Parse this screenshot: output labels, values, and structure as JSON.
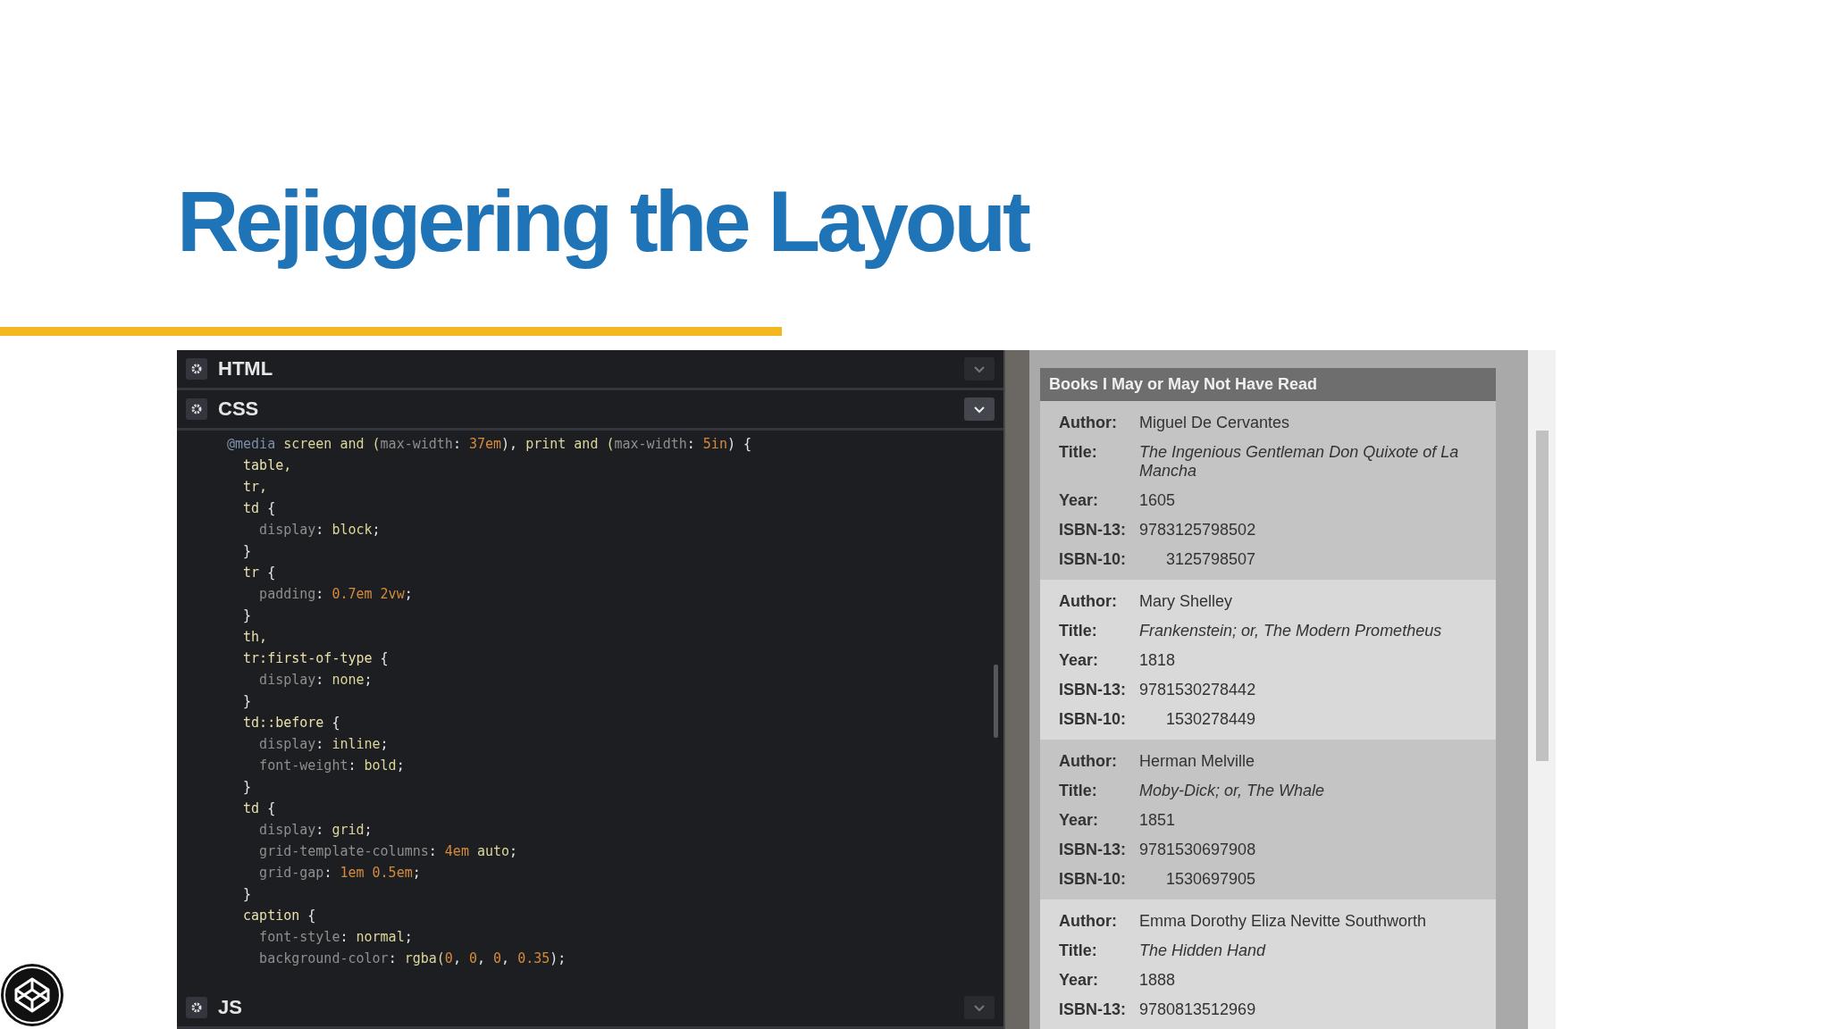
{
  "slide": {
    "title": "Rejiggering the Layout"
  },
  "editor": {
    "panels": [
      {
        "label": "HTML",
        "expanded": false
      },
      {
        "label": "CSS",
        "expanded": true
      },
      {
        "label": "JS",
        "expanded": false
      }
    ],
    "css_lines": [
      [
        {
          "kind": "at",
          "text": "@media"
        },
        {
          "kind": "val",
          "text": " screen and ("
        },
        {
          "kind": "prop",
          "text": "max-width"
        },
        {
          "kind": "punct",
          "text": ": "
        },
        {
          "kind": "num",
          "text": "37em"
        },
        {
          "kind": "punct",
          "text": "), "
        },
        {
          "kind": "val",
          "text": "print and ("
        },
        {
          "kind": "prop",
          "text": "max-width"
        },
        {
          "kind": "punct",
          "text": ": "
        },
        {
          "kind": "num",
          "text": "5in"
        },
        {
          "kind": "punct",
          "text": ") {"
        }
      ],
      [
        {
          "kind": "sel",
          "text": "  table,"
        }
      ],
      [
        {
          "kind": "sel",
          "text": "  tr,"
        }
      ],
      [
        {
          "kind": "sel",
          "text": "  td"
        },
        {
          "kind": "punct",
          "text": " {"
        }
      ],
      [
        {
          "kind": "prop",
          "text": "    display"
        },
        {
          "kind": "punct",
          "text": ": "
        },
        {
          "kind": "val",
          "text": "block"
        },
        {
          "kind": "punct",
          "text": ";"
        }
      ],
      [
        {
          "kind": "punct",
          "text": "  }"
        }
      ],
      [
        {
          "kind": "sel",
          "text": "  tr"
        },
        {
          "kind": "punct",
          "text": " {"
        }
      ],
      [
        {
          "kind": "prop",
          "text": "    padding"
        },
        {
          "kind": "punct",
          "text": ": "
        },
        {
          "kind": "num",
          "text": "0.7em 2vw"
        },
        {
          "kind": "punct",
          "text": ";"
        }
      ],
      [
        {
          "kind": "punct",
          "text": "  }"
        }
      ],
      [
        {
          "kind": "sel",
          "text": "  th,"
        }
      ],
      [
        {
          "kind": "sel",
          "text": "  tr:first-of-type"
        },
        {
          "kind": "punct",
          "text": " {"
        }
      ],
      [
        {
          "kind": "prop",
          "text": "    display"
        },
        {
          "kind": "punct",
          "text": ": "
        },
        {
          "kind": "val",
          "text": "none"
        },
        {
          "kind": "punct",
          "text": ";"
        }
      ],
      [
        {
          "kind": "punct",
          "text": "  }"
        }
      ],
      [
        {
          "kind": "sel",
          "text": "  td::before"
        },
        {
          "kind": "punct",
          "text": " {"
        }
      ],
      [
        {
          "kind": "prop",
          "text": "    display"
        },
        {
          "kind": "punct",
          "text": ": "
        },
        {
          "kind": "val",
          "text": "inline"
        },
        {
          "kind": "punct",
          "text": ";"
        }
      ],
      [
        {
          "kind": "prop",
          "text": "    font-weight"
        },
        {
          "kind": "punct",
          "text": ": "
        },
        {
          "kind": "val",
          "text": "bold"
        },
        {
          "kind": "punct",
          "text": ";"
        }
      ],
      [
        {
          "kind": "punct",
          "text": "  }"
        }
      ],
      [
        {
          "kind": "sel",
          "text": "  td"
        },
        {
          "kind": "punct",
          "text": " {"
        }
      ],
      [
        {
          "kind": "prop",
          "text": "    display"
        },
        {
          "kind": "punct",
          "text": ": "
        },
        {
          "kind": "val",
          "text": "grid"
        },
        {
          "kind": "punct",
          "text": ";"
        }
      ],
      [
        {
          "kind": "prop",
          "text": "    grid-template-columns"
        },
        {
          "kind": "punct",
          "text": ": "
        },
        {
          "kind": "num",
          "text": "4em"
        },
        {
          "kind": "val",
          "text": " auto"
        },
        {
          "kind": "punct",
          "text": ";"
        }
      ],
      [
        {
          "kind": "prop",
          "text": "    grid-gap"
        },
        {
          "kind": "punct",
          "text": ": "
        },
        {
          "kind": "num",
          "text": "1em 0.5em"
        },
        {
          "kind": "punct",
          "text": ";"
        }
      ],
      [
        {
          "kind": "punct",
          "text": "  }"
        }
      ],
      [
        {
          "kind": "sel",
          "text": "  caption"
        },
        {
          "kind": "punct",
          "text": " {"
        }
      ],
      [
        {
          "kind": "prop",
          "text": "    font-style"
        },
        {
          "kind": "punct",
          "text": ": "
        },
        {
          "kind": "val",
          "text": "normal"
        },
        {
          "kind": "punct",
          "text": ";"
        }
      ],
      [
        {
          "kind": "prop",
          "text": "    background-color"
        },
        {
          "kind": "punct",
          "text": ": "
        },
        {
          "kind": "val",
          "text": "rgba("
        },
        {
          "kind": "num",
          "text": "0"
        },
        {
          "kind": "punct",
          "text": ", "
        },
        {
          "kind": "num",
          "text": "0"
        },
        {
          "kind": "punct",
          "text": ", "
        },
        {
          "kind": "num",
          "text": "0"
        },
        {
          "kind": "punct",
          "text": ", "
        },
        {
          "kind": "num",
          "text": "0.35"
        },
        {
          "kind": "punct",
          "text": ");"
        }
      ]
    ]
  },
  "preview": {
    "caption": "Books I May or May Not Have Read",
    "books": [
      {
        "fields": [
          {
            "label": "Author:",
            "value": "Miguel De Cervantes",
            "kind": "plain"
          },
          {
            "label": "Title:",
            "value": "The Ingenious Gentleman Don Quixote of La Mancha",
            "kind": "italic"
          },
          {
            "label": "Year:",
            "value": "1605",
            "kind": "plain"
          },
          {
            "label": "ISBN-13:",
            "value": "9783125798502",
            "kind": "plain"
          },
          {
            "label": "ISBN-10:",
            "value": "3125798507",
            "kind": "indented"
          }
        ]
      },
      {
        "fields": [
          {
            "label": "Author:",
            "value": "Mary Shelley",
            "kind": "plain"
          },
          {
            "label": "Title:",
            "value": "Frankenstein; or, The Modern Prometheus",
            "kind": "italic"
          },
          {
            "label": "Year:",
            "value": "1818",
            "kind": "plain"
          },
          {
            "label": "ISBN-13:",
            "value": "9781530278442",
            "kind": "plain"
          },
          {
            "label": "ISBN-10:",
            "value": "1530278449",
            "kind": "indented"
          }
        ]
      },
      {
        "fields": [
          {
            "label": "Author:",
            "value": "Herman Melville",
            "kind": "plain"
          },
          {
            "label": "Title:",
            "value": "Moby-Dick; or, The Whale",
            "kind": "italic"
          },
          {
            "label": "Year:",
            "value": "1851",
            "kind": "plain"
          },
          {
            "label": "ISBN-13:",
            "value": "9781530697908",
            "kind": "plain"
          },
          {
            "label": "ISBN-10:",
            "value": "1530697905",
            "kind": "indented"
          }
        ]
      },
      {
        "fields": [
          {
            "label": "Author:",
            "value": "Emma Dorothy Eliza Nevitte Southworth",
            "kind": "plain"
          },
          {
            "label": "Title:",
            "value": "The Hidden Hand",
            "kind": "italic"
          },
          {
            "label": "Year:",
            "value": "1888",
            "kind": "plain"
          },
          {
            "label": "ISBN-13:",
            "value": "9780813512969",
            "kind": "plain"
          }
        ]
      }
    ]
  }
}
